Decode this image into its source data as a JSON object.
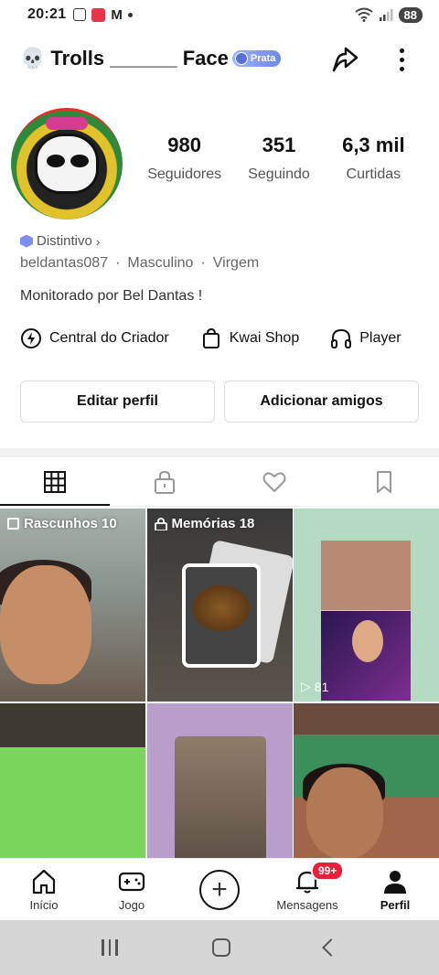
{
  "status_bar": {
    "time": "20:21",
    "battery": "88"
  },
  "header": {
    "skull": "💀",
    "title": "Trolls ______ Face",
    "badge": "Prata"
  },
  "profile": {
    "stats": [
      {
        "value": "980",
        "label": "Seguidores"
      },
      {
        "value": "351",
        "label": "Seguindo"
      },
      {
        "value": "6,3 mil",
        "label": "Curtidas"
      }
    ],
    "distintivo": "Distintivo",
    "username": "beldantas087",
    "gender": "Masculino",
    "sign": "Virgem",
    "bio": "Monitorado por Bel Dantas !"
  },
  "links": [
    {
      "label": "Central do Criador",
      "icon": "lightning-icon"
    },
    {
      "label": "Kwai Shop",
      "icon": "shopping-bag-icon"
    },
    {
      "label": "Player",
      "icon": "headphones-icon"
    }
  ],
  "buttons": {
    "edit": "Editar perfil",
    "add": "Adicionar amigos"
  },
  "grid": {
    "drafts": "Rascunhos 10",
    "memories": "Memórias 18",
    "plays": "81"
  },
  "bottom_nav": [
    {
      "label": "Início",
      "icon": "home-icon"
    },
    {
      "label": "Jogo",
      "icon": "gamepad-icon"
    },
    {
      "label": "",
      "icon": "plus-icon"
    },
    {
      "label": "Mensagens",
      "icon": "bell-icon",
      "badge": "99+"
    },
    {
      "label": "Perfil",
      "icon": "person-icon"
    }
  ]
}
